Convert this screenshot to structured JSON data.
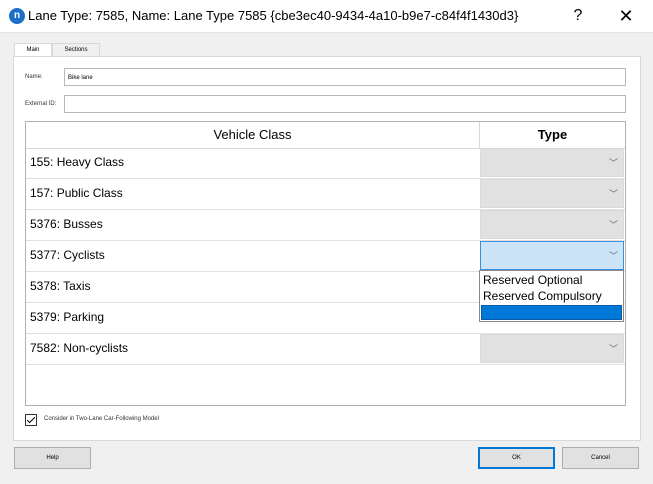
{
  "window": {
    "title": "Lane Type: 7585, Name: Lane Type 7585  {cbe3ec40-9434-4a10-b9e7-c84f4f1430d3}",
    "icon_text": "n",
    "help_glyph": "?",
    "close_glyph": "✕"
  },
  "tabs": [
    "Main",
    "Sections"
  ],
  "fields": {
    "name_label": "Name:",
    "name_value": "Bike lane",
    "external_id_label": "External ID:",
    "external_id_value": ""
  },
  "table": {
    "headers": [
      "Vehicle Class",
      "Type"
    ],
    "rows": [
      "155: Heavy Class",
      "157: Public Class",
      "5376: Busses",
      "5377: Cyclists",
      "5378: Taxis",
      "5379: Parking",
      "7582: Non-cyclists"
    ],
    "chevron": "﹀"
  },
  "dropdown": {
    "options": [
      "Reserved Optional",
      "Reserved Compulsory",
      ""
    ]
  },
  "checkbox": {
    "label": "Consider in Two-Lane Car-Following Model",
    "checked": true
  },
  "buttons": {
    "help": "Help",
    "ok": "OK",
    "cancel": "Cancel"
  }
}
